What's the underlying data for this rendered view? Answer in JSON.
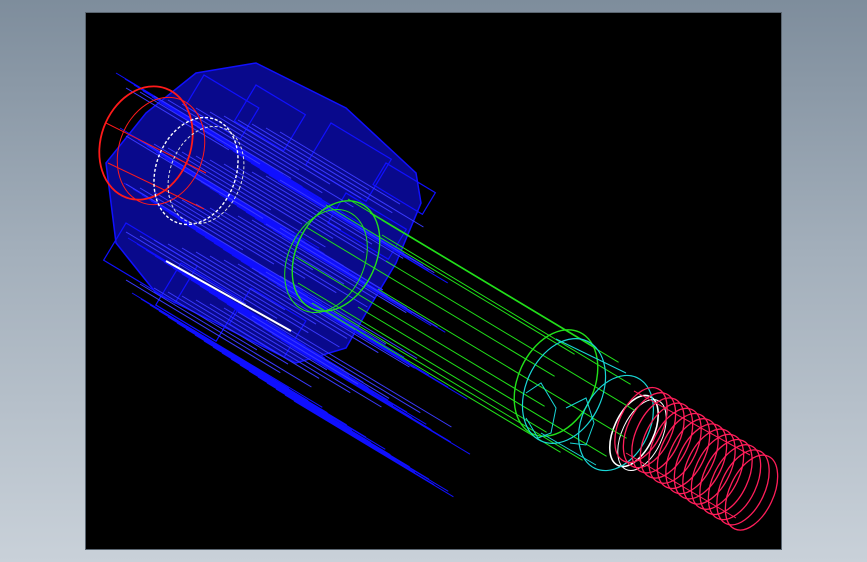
{
  "background": {
    "top": "#7e8d9c",
    "bottom": "#c9d1d9"
  },
  "viewport": {
    "fill": "#000000"
  },
  "parts": [
    {
      "name": "gear-body",
      "color": "#1010ff"
    },
    {
      "name": "gear-bore-ring",
      "color": "#ff1a1a"
    },
    {
      "name": "inner-bore-edge",
      "color": "#ffffff"
    },
    {
      "name": "shaft",
      "color": "#22e01a"
    },
    {
      "name": "shaft-collar",
      "color": "#19d6d6"
    },
    {
      "name": "thread",
      "color": "#ff1e5a"
    }
  ]
}
